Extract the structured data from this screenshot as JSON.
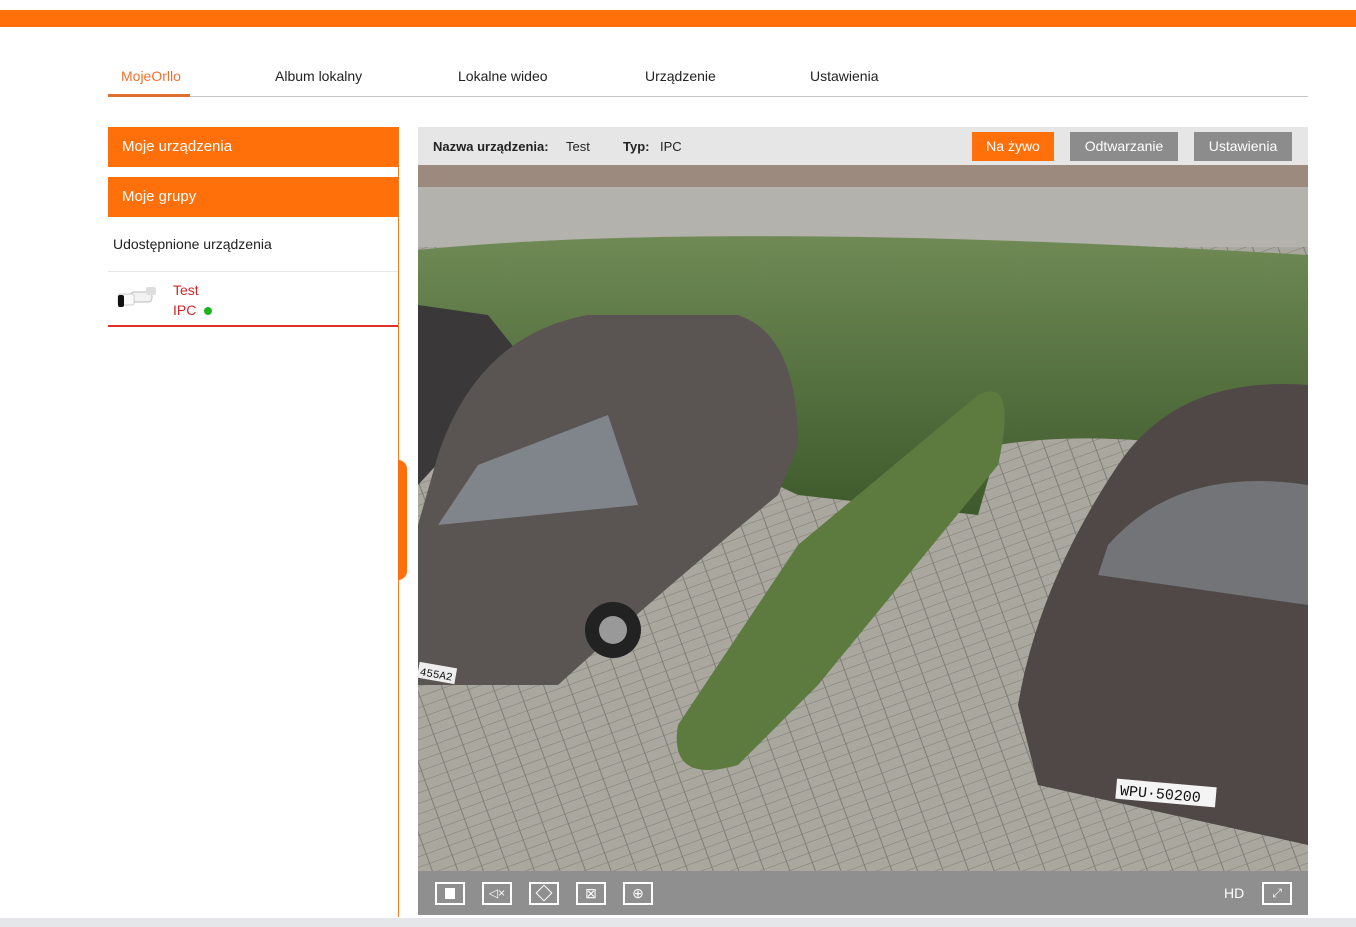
{
  "nav": {
    "tabs": [
      {
        "label": "MojeOrllo",
        "active": true
      },
      {
        "label": "Album lokalny"
      },
      {
        "label": "Lokalne wideo"
      },
      {
        "label": "Urządzenie"
      },
      {
        "label": "Ustawienia"
      }
    ]
  },
  "sidebar": {
    "my_devices": "Moje urządzenia",
    "my_groups": "Moje grupy",
    "shared": "Udostępnione urządzenia",
    "device": {
      "name": "Test",
      "type": "IPC",
      "status": "online",
      "status_color": "#1cb31c"
    }
  },
  "panel": {
    "name_label": "Nazwa urządzenia:",
    "name_value": "Test",
    "type_label": "Typ:",
    "type_value": "IPC",
    "buttons": {
      "live": "Na żywo",
      "playback": "Odtwarzanie",
      "settings": "Ustawienia"
    },
    "video": {
      "plate1": "WPU·50200",
      "plate2": "455A2"
    },
    "controls": {
      "quality": "HD"
    }
  },
  "colors": {
    "accent": "#ff6f0a",
    "button_gray": "#8c8c8c"
  }
}
